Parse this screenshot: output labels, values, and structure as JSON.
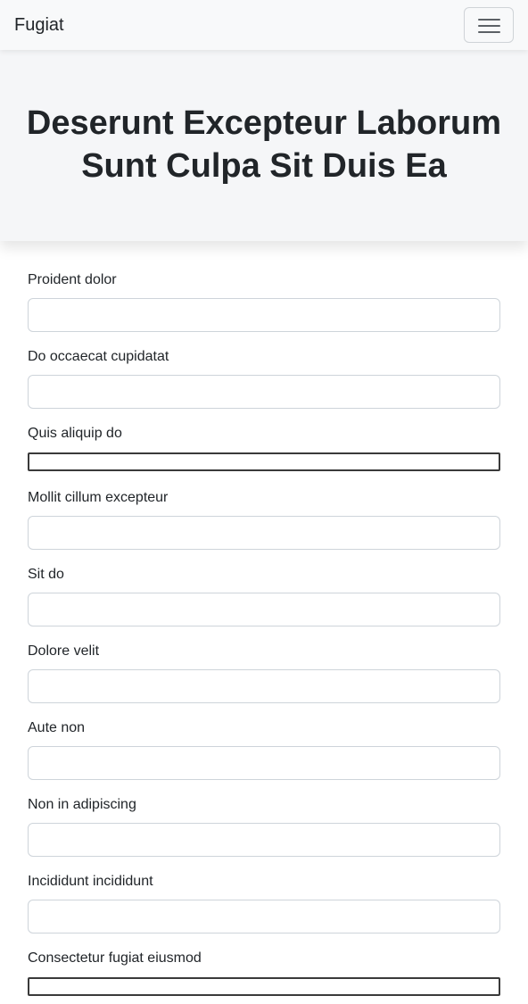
{
  "navbar": {
    "brand": "Fugiat",
    "toggler_icon": "hamburger-menu-icon"
  },
  "hero": {
    "title": "Deserunt Excepteur Laborum Sunt Culpa Sit Duis Ea"
  },
  "form": {
    "fields": [
      {
        "label": "Proident dolor",
        "value": "",
        "placeholder": ""
      },
      {
        "label": "Do occaecat cupidatat",
        "value": "",
        "placeholder": ""
      },
      {
        "label": "Quis aliquip do",
        "value": "",
        "placeholder": ""
      },
      {
        "label": "Mollit cillum excepteur",
        "value": "",
        "placeholder": ""
      },
      {
        "label": "Sit do",
        "value": "",
        "placeholder": ""
      },
      {
        "label": "Dolore velit",
        "value": "",
        "placeholder": ""
      },
      {
        "label": "Aute non",
        "value": "",
        "placeholder": ""
      },
      {
        "label": "Non in adipiscing",
        "value": "",
        "placeholder": ""
      },
      {
        "label": "Incididunt incididunt",
        "value": "",
        "placeholder": ""
      },
      {
        "label": "Consectetur fugiat eiusmod",
        "value": "",
        "placeholder": ""
      }
    ]
  },
  "colors": {
    "navbar_bg": "#f8f9fa",
    "hero_bg": "#f5f6f8",
    "text": "#212529",
    "input_border": "#ced4da"
  }
}
